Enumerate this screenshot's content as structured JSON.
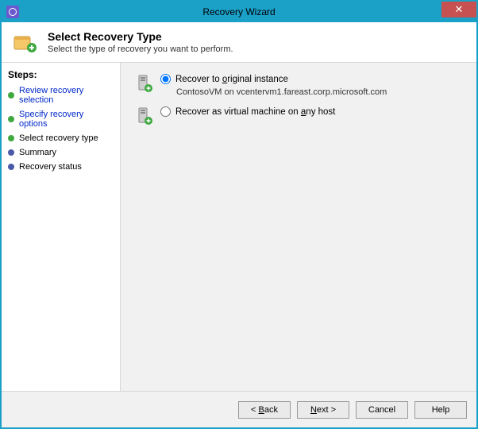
{
  "window": {
    "title": "Recovery Wizard"
  },
  "header": {
    "title": "Select Recovery Type",
    "subtitle": "Select the type of recovery you want to perform."
  },
  "steps": {
    "heading": "Steps:",
    "items": [
      {
        "label": "Review recovery selection",
        "state": "done",
        "link": true
      },
      {
        "label": "Specify recovery options",
        "state": "done",
        "link": true
      },
      {
        "label": "Select recovery type",
        "state": "current",
        "link": false
      },
      {
        "label": "Summary",
        "state": "pending",
        "link": false
      },
      {
        "label": "Recovery status",
        "state": "pending",
        "link": false
      }
    ]
  },
  "options": {
    "original": {
      "label_pre": "Recover to ",
      "label_accel": "o",
      "label_post": "riginal instance",
      "detail": "ContosoVM on vcentervm1.fareast.corp.microsoft.com",
      "selected": true
    },
    "anyhost": {
      "label_pre": "Recover as virtual machine on ",
      "label_accel": "a",
      "label_post": "ny host",
      "selected": false
    }
  },
  "buttons": {
    "back_pre": "< ",
    "back_accel": "B",
    "back_post": "ack",
    "next_pre": "",
    "next_accel": "N",
    "next_post": "ext >",
    "cancel": "Cancel",
    "help": "Help"
  }
}
